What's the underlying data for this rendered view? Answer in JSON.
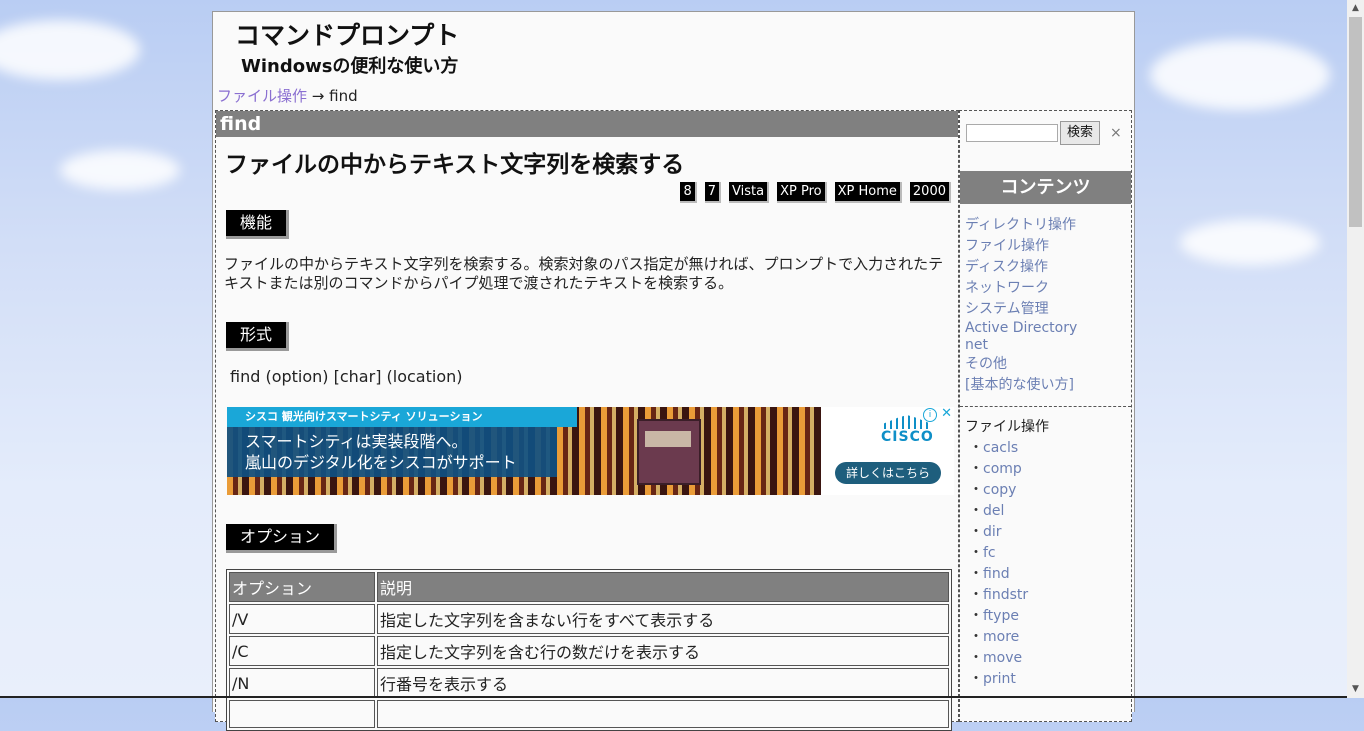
{
  "site": {
    "title": "コマンドプロンプト",
    "subtitle": "Windowsの便利な使い方"
  },
  "breadcrumb": {
    "link": "ファイル操作",
    "arrow": "→",
    "current": "find"
  },
  "main": {
    "header": "find",
    "title": "ファイルの中からテキスト文字列を検索する",
    "os_tags": [
      "8",
      "7",
      "Vista",
      "XP Pro",
      "XP Home",
      "2000"
    ],
    "function_label": "機能",
    "description": "ファイルの中からテキスト文字列を検索する。検索対象のパス指定が無ければ、プロンプトで入力されたテキストまたは別のコマンドからパイプ処理で渡されたテキストを検索する。",
    "format_label": "形式",
    "syntax": "find (option) [char] (location)",
    "options_label": "オプション",
    "table": {
      "headers": [
        "オプション",
        "説明"
      ],
      "rows": [
        [
          "/V",
          "指定した文字列を含まない行をすべて表示する"
        ],
        [
          "/C",
          "指定した文字列を含む行の数だけを表示する"
        ],
        [
          "/N",
          "行番号を表示する"
        ],
        [
          "",
          ""
        ]
      ]
    }
  },
  "ad": {
    "top_text": "シスコ 観光向けスマートシティ ソリューション",
    "line1": "スマートシティは実装段階へ。",
    "line2": "嵐山のデジタル化をシスコがサポート",
    "brand": "CISCO",
    "cta": "詳しくはこちら",
    "info": "i",
    "close": "✕"
  },
  "sidebar": {
    "search_button": "検索",
    "search_clear": "×",
    "contents_header": "コンテンツ",
    "nav": [
      "ディレクトリ操作",
      "ファイル操作",
      "ディスク操作",
      "ネットワーク",
      "システム管理",
      "Active Directory",
      "net",
      "その他",
      "[基本的な使い方]"
    ],
    "list_title": "ファイル操作",
    "list_items": [
      "cacls",
      "comp",
      "copy",
      "del",
      "dir",
      "fc",
      "find",
      "findstr",
      "ftype",
      "more",
      "move",
      "print"
    ]
  },
  "colors": {
    "header_gray": "#808080",
    "link": "#6b7fb3",
    "breadcrumb_link": "#8a6fd1",
    "ad_blue": "#1aa7d8"
  },
  "icons": {
    "scroll_up": "up-arrow-icon",
    "scroll_down": "down-arrow-icon"
  }
}
